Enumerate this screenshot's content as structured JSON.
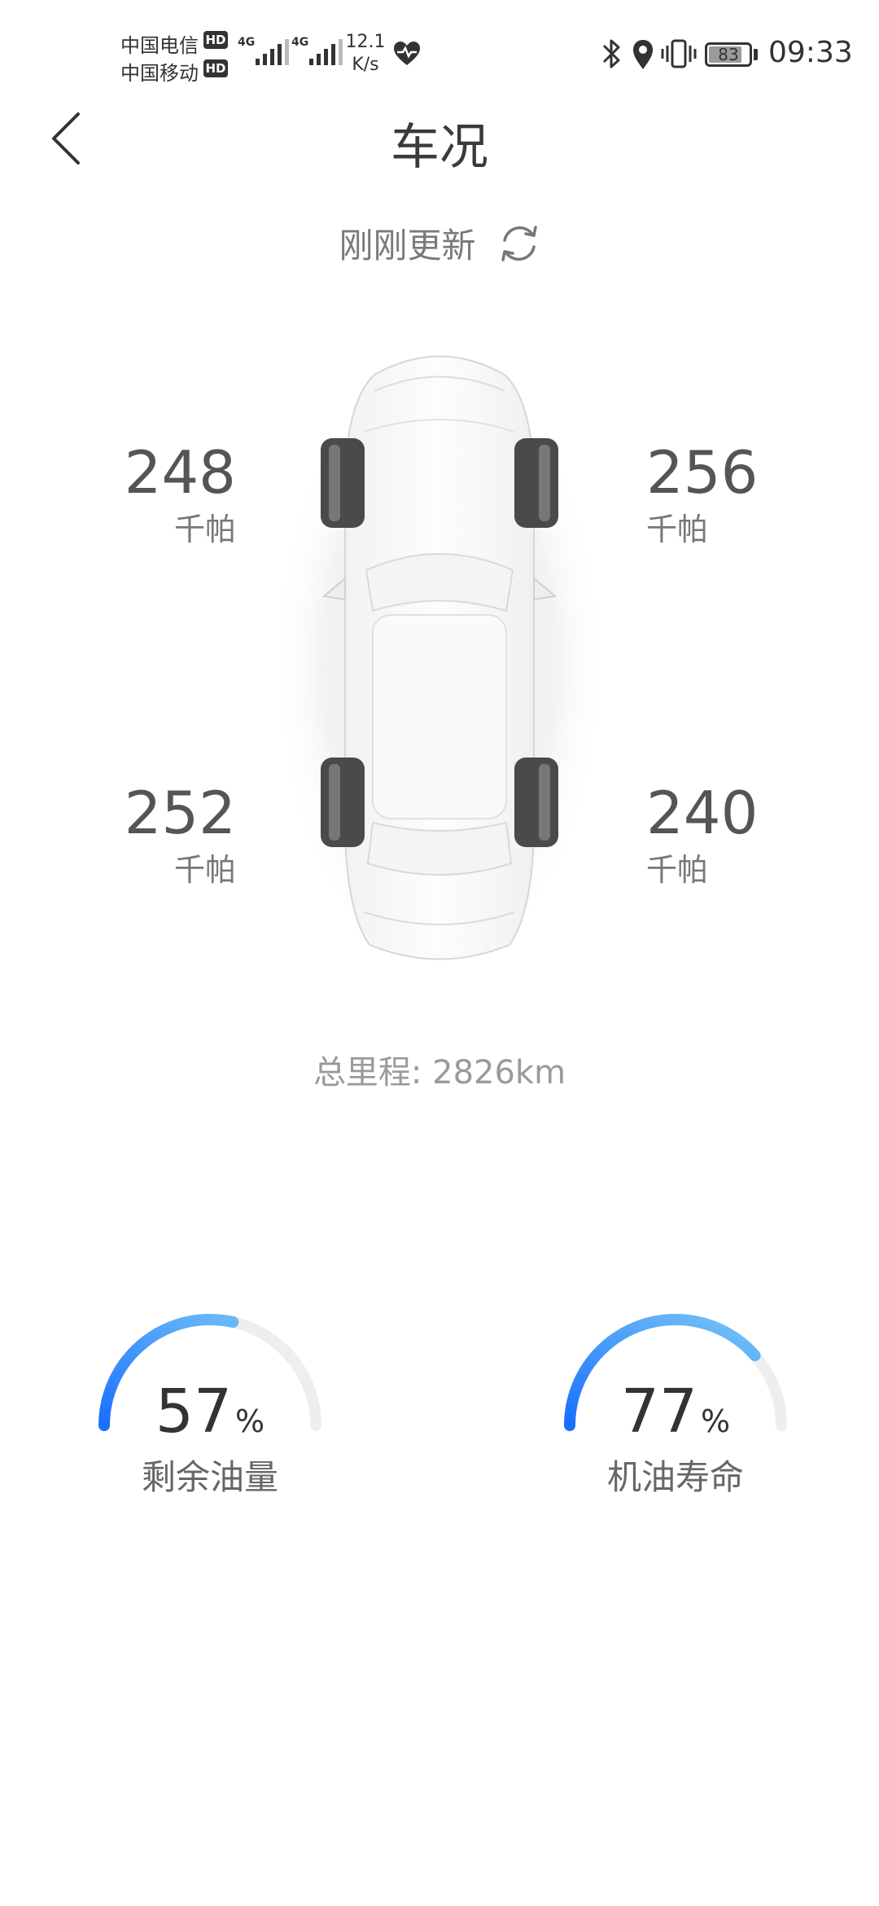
{
  "status_bar": {
    "carrier_1": "中国电信",
    "carrier_2": "中国移动",
    "hd_badge": "HD",
    "network_type": "4G",
    "speed_value": "12.1",
    "speed_unit": "K/s",
    "battery_level": 83,
    "battery_label": "83",
    "time": "09:33",
    "icons": [
      "heart-pulse-icon",
      "bluetooth-icon",
      "location-icon",
      "vibrate-icon",
      "battery-icon"
    ]
  },
  "header": {
    "title": "车况",
    "back_icon": "chevron-left-icon"
  },
  "update": {
    "text": "刚刚更新",
    "icon": "refresh-icon"
  },
  "tires": {
    "front_left": {
      "value": "248",
      "unit": "千帕"
    },
    "front_right": {
      "value": "256",
      "unit": "千帕"
    },
    "rear_left": {
      "value": "252",
      "unit": "千帕"
    },
    "rear_right": {
      "value": "240",
      "unit": "千帕"
    }
  },
  "mileage": {
    "text": "总里程: 2826km"
  },
  "gauges": [
    {
      "value": 57,
      "value_text": "57",
      "unit": "%",
      "label": "剩余油量"
    },
    {
      "value": 77,
      "value_text": "77",
      "unit": "%",
      "label": "机油寿命"
    }
  ],
  "colors": {
    "gauge_start": "#1a6fff",
    "gauge_end": "#7ccbf6",
    "gauge_track": "#eeeeee",
    "text_primary": "#333333"
  }
}
